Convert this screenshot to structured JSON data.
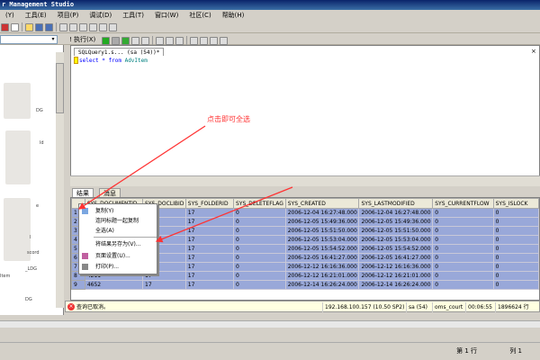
{
  "app": {
    "title": "r Management Studio"
  },
  "menu": [
    "(Y)",
    "工具(E)",
    "项目(P)",
    "调试(D)",
    "工具(T)",
    "窗口(W)",
    "社区(C)",
    "帮助(H)"
  ],
  "toolbar": {
    "db_value": "",
    "execute_label": "! 执行(X)"
  },
  "left_panel": {
    "items": [
      "DG",
      "ld",
      "e",
      "l",
      "scord",
      "_LDG",
      "Item",
      "DG"
    ]
  },
  "editor": {
    "tab_title": "SQLQuery1.s... (sa (54))*",
    "close": "×",
    "sql_keyword": "select * from ",
    "sql_object": "AdvItem"
  },
  "annotation": "点击即可全选",
  "results": {
    "tabs": [
      "结果",
      "消息"
    ],
    "columns": [
      "",
      "SYS_DOCUMENTID",
      "SYS_DOCLIBID",
      "SYS_FOLDERID",
      "SYS_DELETEFLAG",
      "SYS_CREATED",
      "SYS_LASTMODIFIED",
      "SYS_CURRENTFLOW",
      "SYS_ISLOCK"
    ],
    "rows": [
      [
        "1",
        "",
        "17",
        "17",
        "0",
        "2006-12-04 16:27:48.000",
        "2006-12-04 16:27:48.000",
        "0",
        "0"
      ],
      [
        "2",
        "",
        "17",
        "17",
        "0",
        "2006-12-05 15:49:36.000",
        "2006-12-05 15:49:36.000",
        "0",
        "0"
      ],
      [
        "3",
        "",
        "17",
        "17",
        "0",
        "2006-12-05 15:51:50.000",
        "2006-12-05 15:51:50.000",
        "0",
        "0"
      ],
      [
        "4",
        "",
        "17",
        "17",
        "0",
        "2006-12-05 15:53:04.000",
        "2006-12-05 15:53:04.000",
        "0",
        "0"
      ],
      [
        "5",
        "",
        "17",
        "17",
        "0",
        "2006-12-05 15:54:52.000",
        "2006-12-05 15:54:52.000",
        "0",
        "0"
      ],
      [
        "6",
        "",
        "17",
        "17",
        "0",
        "2006-12-05 16:41:27.000",
        "2006-12-05 16:41:27.000",
        "0",
        "0"
      ],
      [
        "7",
        "",
        "17",
        "17",
        "0",
        "2006-12-12 16:16:36.000",
        "2006-12-12 16:16:36.000",
        "0",
        "0"
      ],
      [
        "8",
        "4211",
        "17",
        "17",
        "0",
        "2006-12-12 16:21:01.000",
        "2006-12-12 16:21:01.000",
        "0",
        "0"
      ],
      [
        "9",
        "4652",
        "17",
        "17",
        "0",
        "2006-12-14 16:26:24.000",
        "2006-12-14 16:26:24.000",
        "0",
        "0"
      ]
    ]
  },
  "context_menu": {
    "items": [
      "复制(Y)",
      "连同标题一起复制",
      "全选(A)",
      "将结果另存为(V)...",
      "页面设置(U)...",
      "打印(P)..."
    ]
  },
  "status": {
    "message": "查询已取消。",
    "server": "192.168.100.157 (10.50 SP2)",
    "user": "sa (54)",
    "db": "oms_court",
    "time": "00:06:55",
    "rows": "1896624 行"
  },
  "footer": {
    "row": "第 1 行",
    "col": "列 1"
  },
  "colors": {
    "title": "#0a246a",
    "selection": "#99a8d9",
    "annotation": "#ff3333"
  }
}
